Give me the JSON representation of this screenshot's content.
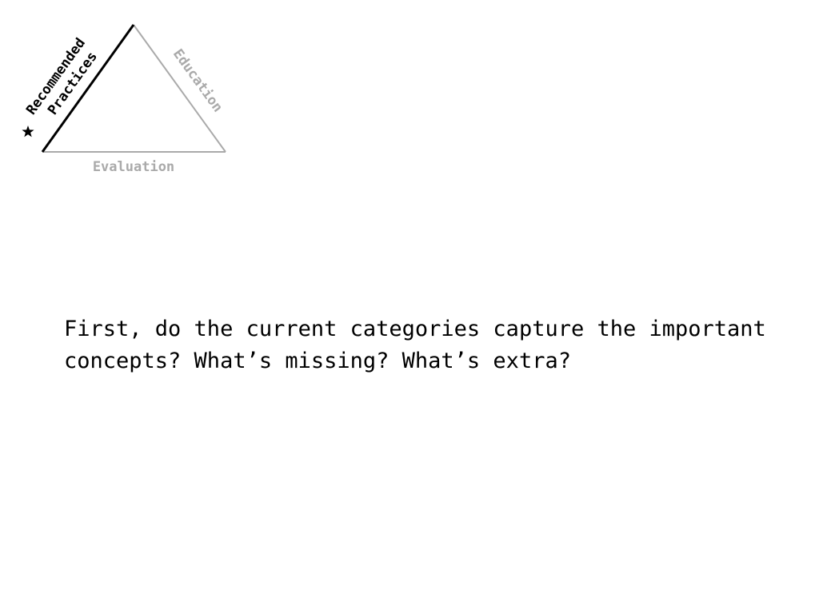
{
  "diagram": {
    "sides": {
      "recommended": {
        "line1": "Recommended",
        "line2": "Practices",
        "color": "#000000",
        "highlighted": true,
        "marker_icon": "star-icon"
      },
      "education": {
        "label": "Education",
        "color": "#aaaaaa",
        "highlighted": false
      },
      "evaluation": {
        "label": "Evaluation",
        "color": "#aaaaaa",
        "highlighted": false
      }
    }
  },
  "question": "First, do the current categories capture the important concepts? What’s missing? What’s extra?"
}
